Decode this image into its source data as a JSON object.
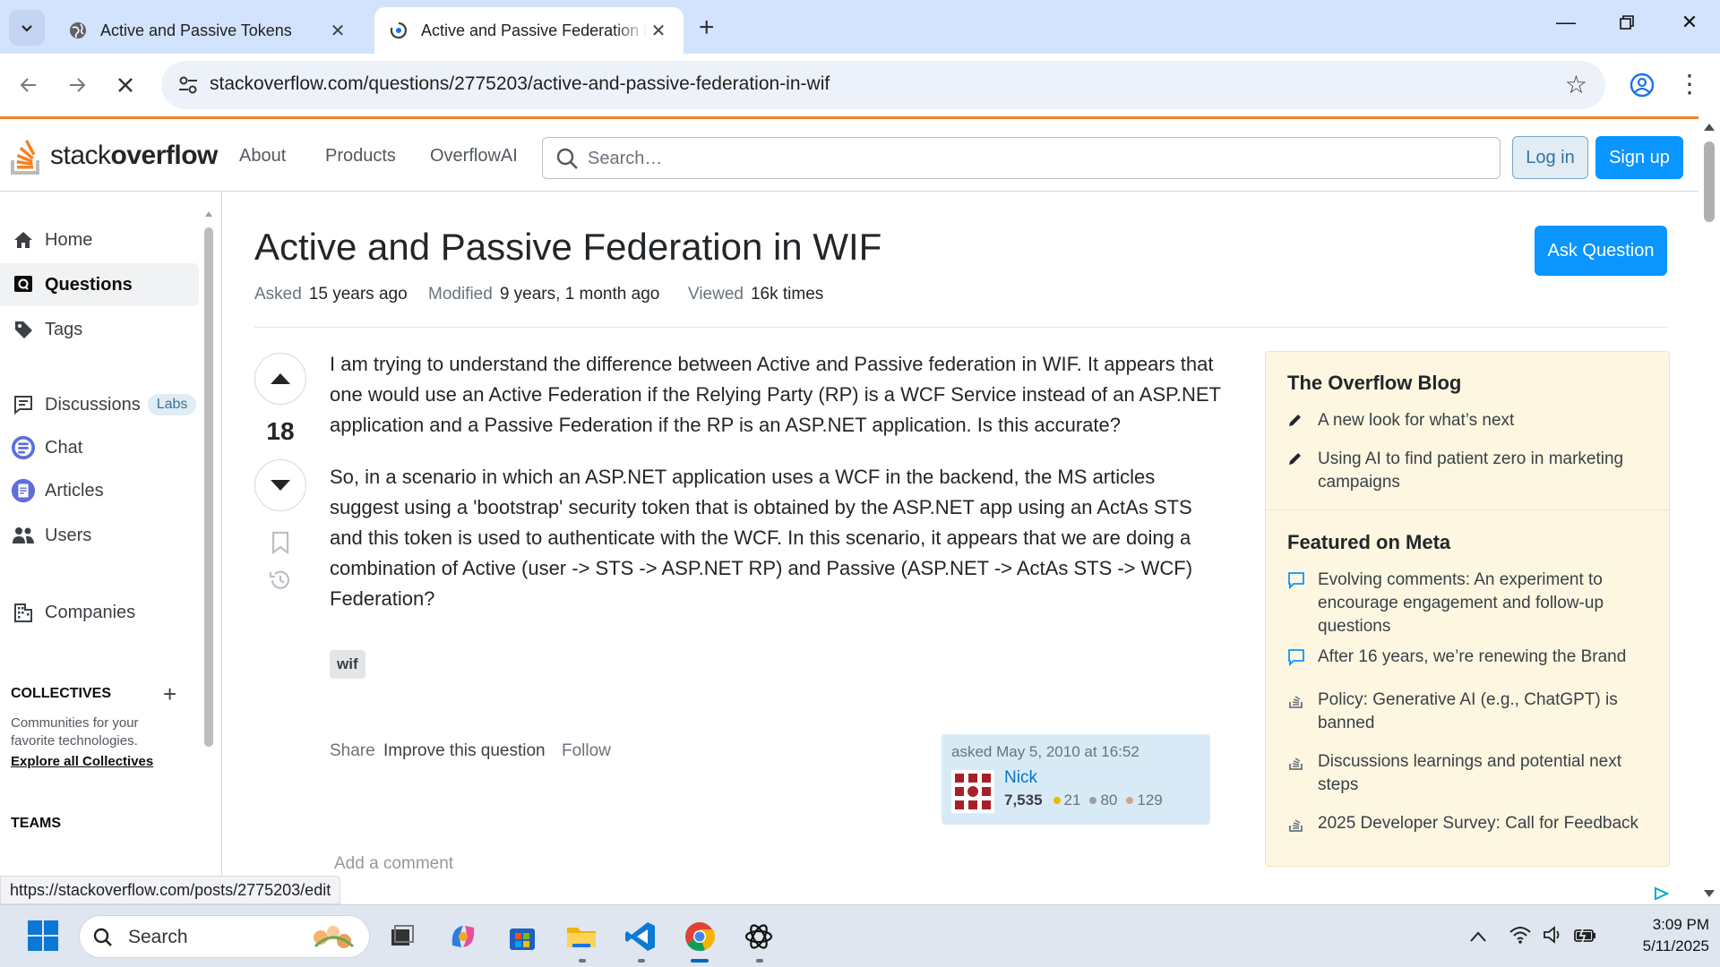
{
  "browser": {
    "tabs": [
      {
        "title": "Active and Passive Tokens"
      },
      {
        "title": "Active and Passive Federation in WIF"
      }
    ],
    "url": "stackoverflow.com/questions/2775203/active-and-passive-federation-in-wif",
    "status_url": "https://stackoverflow.com/posts/2775203/edit"
  },
  "so_header": {
    "logo_prefix": "stack",
    "logo_bold": "overflow",
    "nav": [
      "About",
      "Products",
      "OverflowAI"
    ],
    "search_placeholder": "Search…",
    "login_label": "Log in",
    "signup_label": "Sign up"
  },
  "leftnav": {
    "items": [
      {
        "label": "Home",
        "icon": "home-icon"
      },
      {
        "label": "Questions",
        "icon": "questions-icon",
        "active": true
      },
      {
        "label": "Tags",
        "icon": "tag-icon"
      },
      {
        "label": "Discussions",
        "icon": "discussions-icon",
        "badge": "Labs"
      },
      {
        "label": "Chat",
        "icon": "chat-icon"
      },
      {
        "label": "Articles",
        "icon": "articles-icon"
      },
      {
        "label": "Users",
        "icon": "users-icon"
      },
      {
        "label": "Companies",
        "icon": "companies-icon"
      }
    ],
    "collectives_heading": "COLLECTIVES",
    "collectives_desc": "Communities for your favorite technologies.",
    "collectives_link": "Explore all Collectives",
    "teams_heading": "TEAMS"
  },
  "question": {
    "title": "Active and Passive Federation in WIF",
    "ask_label": "Ask Question",
    "asked_k": "Asked",
    "asked_v": "15 years ago",
    "modified_k": "Modified",
    "modified_v": "9 years, 1 month ago",
    "viewed_k": "Viewed",
    "viewed_v": "16k times",
    "score": "18",
    "paragraphs": [
      "I am trying to understand the difference between Active and Passive federation in WIF. It appears that one would use an Active Federation if the Relying Party (RP) is a WCF Service instead of an ASP.NET application and a Passive Federation if the RP is an ASP.NET application. Is this accurate?",
      "So, in a scenario in which an ASP.NET application uses a WCF in the backend, the MS articles suggest using a 'bootstrap' security token that is obtained by the ASP.NET app using an ActAs STS and this token is used to authenticate with the WCF. In this scenario, it appears that we are doing a combination of Active (user -> STS -> ASP.NET RP) and Passive (ASP.NET -> ActAs STS -> WCF) Federation?"
    ],
    "tag": "wif",
    "share_label": "Share",
    "improve_label": "Improve this question",
    "follow_label": "Follow",
    "add_comment": "Add a comment",
    "user": {
      "asked": "asked May 5, 2010 at 16:52",
      "name": "Nick",
      "rep": "7,535",
      "gold": "21",
      "silver": "80",
      "bronze": "129"
    }
  },
  "sidebar": {
    "blog_heading": "The Overflow Blog",
    "blog_items": [
      "A new look for what’s next",
      "Using AI to find patient zero in marketing campaigns"
    ],
    "meta_heading": "Featured on Meta",
    "meta_items": [
      {
        "text": "Evolving comments: An experiment to encourage engagement and follow-up questions",
        "icon": "comment-icon"
      },
      {
        "text": "After 16 years, we’re renewing the Brand",
        "icon": "comment-icon"
      },
      {
        "text": "Policy: Generative AI (e.g., ChatGPT) is banned",
        "icon": "stack-icon"
      },
      {
        "text": "Discussions learnings and potential next steps",
        "icon": "stack-icon"
      },
      {
        "text": "2025 Developer Survey: Call for Feedback",
        "icon": "stack-icon"
      }
    ]
  },
  "taskbar": {
    "search_label": "Search",
    "time": "3:09 PM",
    "date": "5/11/2025"
  },
  "colors": {
    "so_orange": "#f48225",
    "so_blue": "#0a95ff",
    "link_blue": "#0074cc",
    "sidebar_bg": "#fdf7e2",
    "tabstrip_bg": "#d3e3fd"
  }
}
